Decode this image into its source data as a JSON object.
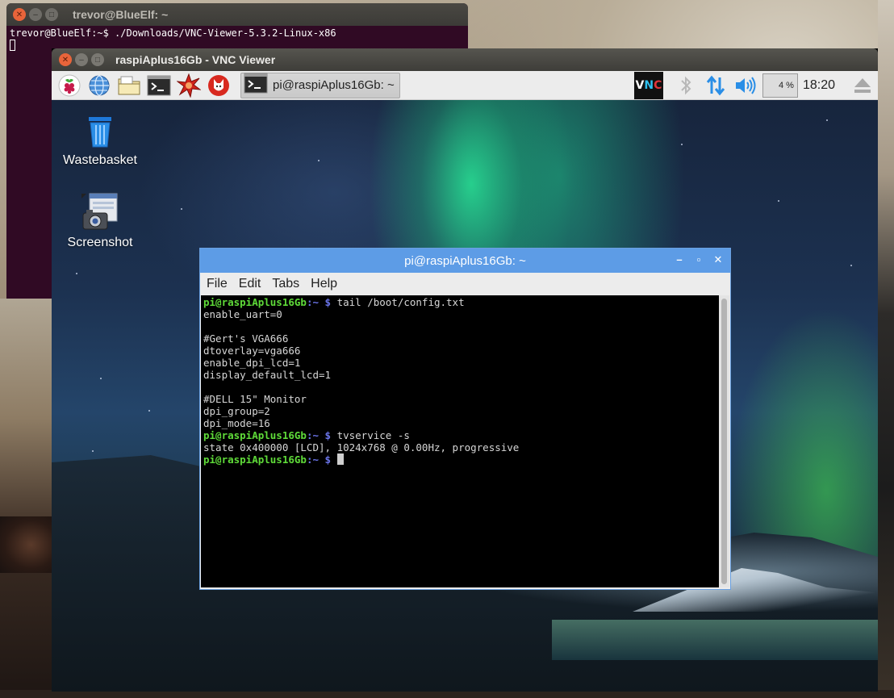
{
  "host_terminal": {
    "title": "trevor@BlueElf: ~",
    "prompt": "trevor@BlueElf:~$",
    "command": " ./Downloads/VNC-Viewer-5.3.2-Linux-x86"
  },
  "vnc_window": {
    "title": "raspiAplus16Gb - VNC Viewer"
  },
  "panel": {
    "launchers": [
      "raspberry-menu-icon",
      "web-browser-icon",
      "file-manager-icon",
      "terminal-icon",
      "mathematica-icon",
      "wolfram-icon"
    ],
    "task_label": "pi@raspiAplus16Gb: ~",
    "cpu_usage": "4 %",
    "clock": "18:20"
  },
  "desktop": {
    "icons": [
      {
        "label": "Wastebasket"
      },
      {
        "label": "Screenshot"
      }
    ]
  },
  "lxterminal": {
    "title": "pi@raspiAplus16Gb: ~",
    "menu": [
      "File",
      "Edit",
      "Tabs",
      "Help"
    ],
    "prompt_user": "pi@raspiAplus16Gb",
    "prompt_path": ":~ $",
    "cmd1": " tail /boot/config.txt",
    "out1": [
      "enable_uart=0",
      "",
      "#Gert's VGA666",
      "dtoverlay=vga666",
      "enable_dpi_lcd=1",
      "display_default_lcd=1",
      "",
      "#DELL 15\" Monitor",
      "dpi_group=2",
      "dpi_mode=16"
    ],
    "cmd2": " tvservice -s",
    "out2": "state 0x400000 [LCD], 1024x768 @ 0.00Hz, progressive",
    "cmd3": " "
  },
  "colors": {
    "prompt_user": "#5fdb39",
    "prompt_path": "#6a74e8",
    "titlebar_blue": "#5d9ce6",
    "ubuntu_terminal_bg": "#300a24"
  }
}
